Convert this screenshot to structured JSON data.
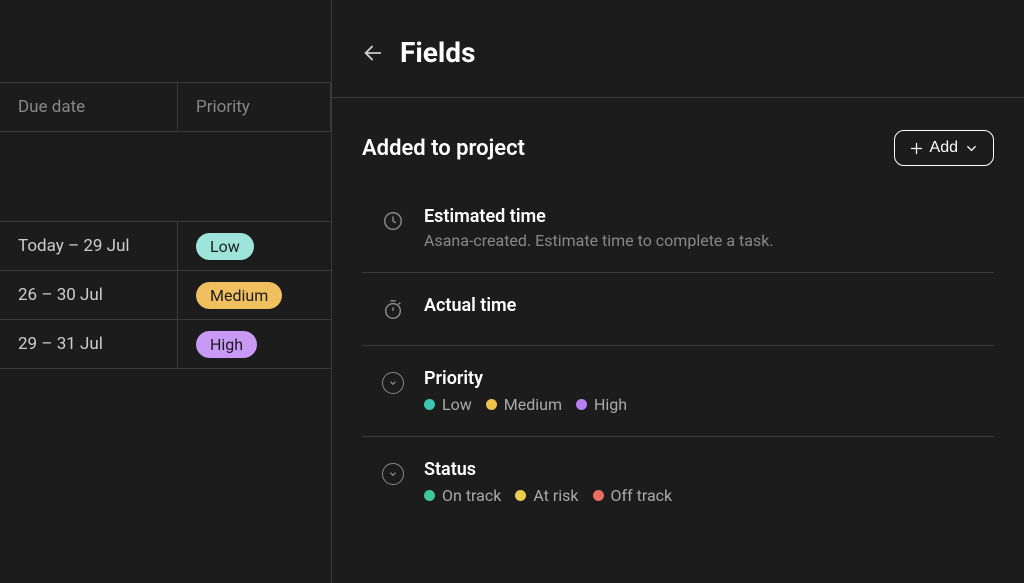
{
  "back_table": {
    "columns": {
      "due": "Due date",
      "priority": "Priority"
    },
    "rows": [
      {
        "due": "Today – 29 Jul",
        "priority": "Low"
      },
      {
        "due": "26 – 30 Jul",
        "priority": "Medium"
      },
      {
        "due": "29 – 31 Jul",
        "priority": "High"
      }
    ]
  },
  "panel": {
    "title": "Fields",
    "section_title": "Added to project",
    "add_label": "Add",
    "fields": {
      "est_time": {
        "name": "Estimated time",
        "desc": "Asana-created. Estimate time to complete a task."
      },
      "actual_time": {
        "name": "Actual time"
      },
      "priority": {
        "name": "Priority",
        "options": {
          "low": "Low",
          "medium": "Medium",
          "high": "High"
        }
      },
      "status": {
        "name": "Status",
        "options": {
          "on_track": "On track",
          "at_risk": "At risk",
          "off_track": "Off track"
        }
      }
    }
  }
}
